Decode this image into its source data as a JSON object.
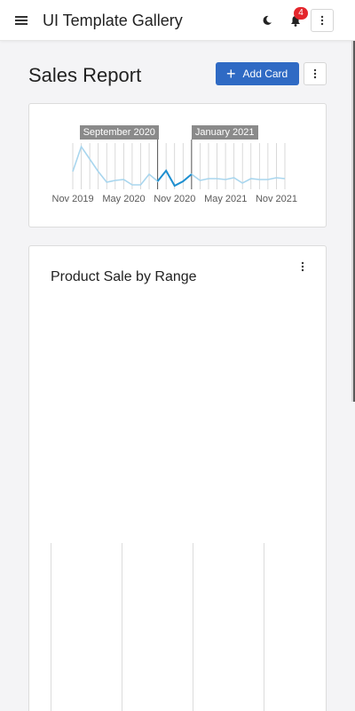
{
  "header": {
    "title": "UI Template Gallery",
    "menu_icon": "hamburger-menu-icon",
    "theme_icon": "moon-icon",
    "notification_icon": "bell-icon",
    "notification_count": "4",
    "overflow_icon": "vertical-ellipsis-icon"
  },
  "page": {
    "title": "Sales Report",
    "add_card_label": "Add Card"
  },
  "colors": {
    "accent": "#2f6ac4",
    "badge": "#e4262c",
    "sparkline_light": "#a9d6ee",
    "sparkline_dark": "#1e8fd0"
  },
  "chart_data": [
    {
      "type": "line",
      "title": "",
      "x_ticks": [
        "Nov 2019",
        "May 2020",
        "Nov 2020",
        "May 2021",
        "Nov 2021"
      ],
      "range_start_label": "September 2020",
      "range_end_label": "January 2021",
      "x": [
        "2019-11",
        "2019-12",
        "2020-01",
        "2020-02",
        "2020-03",
        "2020-04",
        "2020-05",
        "2020-06",
        "2020-07",
        "2020-08",
        "2020-09",
        "2020-10",
        "2020-11",
        "2020-12",
        "2021-01",
        "2021-02",
        "2021-03",
        "2021-04",
        "2021-05",
        "2021-06",
        "2021-07",
        "2021-08",
        "2021-09",
        "2021-10",
        "2021-11",
        "2021-12"
      ],
      "values": [
        20,
        48,
        34,
        20,
        8,
        10,
        11,
        5,
        5,
        17,
        9,
        21,
        4,
        9,
        17,
        10,
        12,
        12,
        11,
        13,
        7,
        12,
        11,
        11,
        13,
        12
      ],
      "ylim": [
        0,
        52
      ],
      "selected_range": [
        "2020-09",
        "2021-01"
      ],
      "grid": true
    },
    {
      "type": "bar",
      "title": "Product Sale by Range",
      "categories": [],
      "values": []
    }
  ]
}
